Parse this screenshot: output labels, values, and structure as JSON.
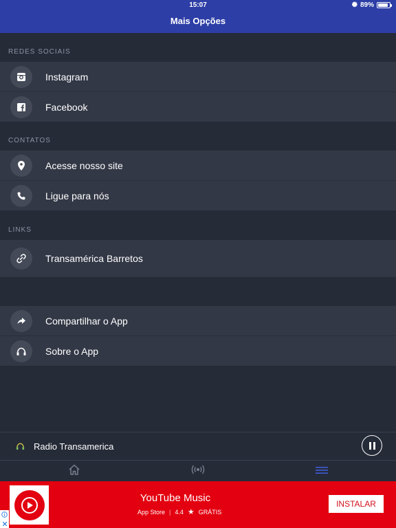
{
  "status_bar": {
    "time": "15:07",
    "battery": "89%",
    "battery_level": 0.89
  },
  "nav": {
    "title": "Mais Opções"
  },
  "sections": [
    {
      "label": "REDES SOCIAIS",
      "items": [
        {
          "label": "Instagram",
          "icon": "instagram-icon"
        },
        {
          "label": "Facebook",
          "icon": "facebook-icon"
        }
      ]
    },
    {
      "label": "CONTATOS",
      "items": [
        {
          "label": "Acesse nosso site",
          "icon": "location-pin-icon"
        },
        {
          "label": "Ligue para nós",
          "icon": "phone-icon"
        }
      ]
    },
    {
      "label": "LINKS",
      "items": [
        {
          "label": "Transamérica Barretos",
          "icon": "link-icon"
        }
      ]
    },
    {
      "label": "",
      "items": [
        {
          "label": "Compartilhar o App",
          "icon": "share-icon"
        },
        {
          "label": "Sobre o App",
          "icon": "headphones-icon"
        }
      ]
    }
  ],
  "player": {
    "station": "Radio Transamerica",
    "state": "playing"
  },
  "tabs": [
    {
      "icon": "home-icon",
      "active": false
    },
    {
      "icon": "radio-broadcast-icon",
      "active": false
    },
    {
      "icon": "menu-icon",
      "active": true
    }
  ],
  "ad": {
    "title": "YouTube Music",
    "store": "App Store",
    "rating": "4.4",
    "price": "GRÁTIS",
    "cta": "INSTALAR"
  },
  "colors": {
    "header": "#2d3ea6",
    "background": "#262b38",
    "row": "#333846",
    "ad": "#e30010",
    "active_tab": "#3f5bd6"
  }
}
